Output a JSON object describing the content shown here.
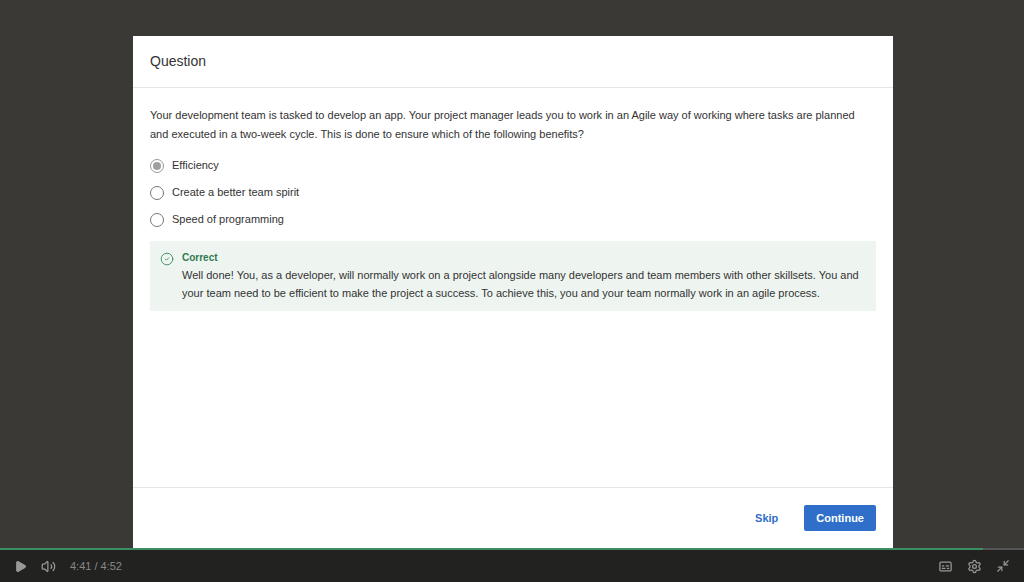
{
  "modal": {
    "title": "Question",
    "question": "Your development team is tasked to develop an app. Your project manager leads you to work in an Agile way of working where tasks are planned and executed in a two-week cycle.  This is done to ensure which of the following benefits?",
    "options": [
      {
        "label": "Efficiency",
        "selected": true
      },
      {
        "label": "Create a better team spirit",
        "selected": false
      },
      {
        "label": "Speed of programming",
        "selected": false
      }
    ],
    "feedback": {
      "status": "Correct",
      "message": "Well done! You, as a developer, will normally work on a project alongside many developers and team members with other skillsets. You and your team need to be efficient to make the project a success. To achieve this, you and your team normally work in an agile process."
    },
    "buttons": [
      {
        "label": "Skip",
        "kind": "link"
      },
      {
        "label": "Continue",
        "kind": "primary"
      }
    ]
  },
  "player": {
    "time": "4:41 / 4:52",
    "progress": 0.96,
    "playing": false
  }
}
